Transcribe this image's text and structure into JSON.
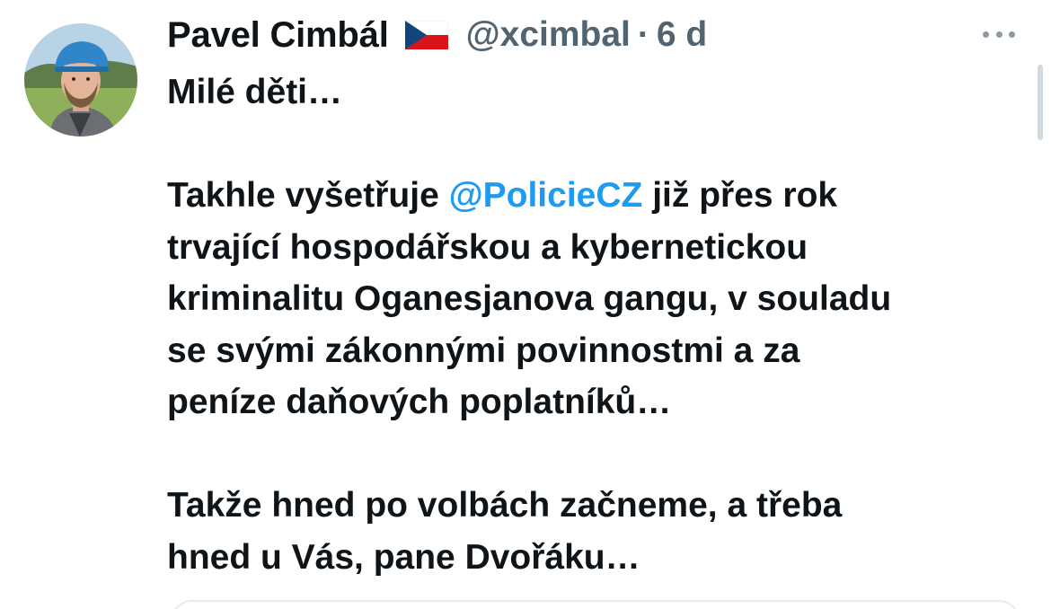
{
  "author": {
    "name": "Pavel Cimbál",
    "handle": "@xcimbal",
    "separator": "·",
    "time": "6 d",
    "flag_icon": "czech-flag-icon"
  },
  "tweet": {
    "line1": "Milé děti…",
    "line2_before": "Takhle vyšetřuje ",
    "line2_mention": "@PolicieCZ",
    "line2_after": " již přes rok",
    "line3": "trvající hospodářskou a kybernetickou",
    "line4": "kriminalitu Oganesjanova gangu, v souladu",
    "line5": "se svými zákonnými povinnostmi a za",
    "line6": "peníze daňových poplatníků…",
    "line7": "Takže hned po volbách začneme, a třeba",
    "line8": "hned u Vás, pane Dvořáku…"
  },
  "colors": {
    "text": "#0f1419",
    "secondary": "#536471",
    "link": "#1d9bf0"
  },
  "icons": {
    "more": "more-options-icon"
  }
}
